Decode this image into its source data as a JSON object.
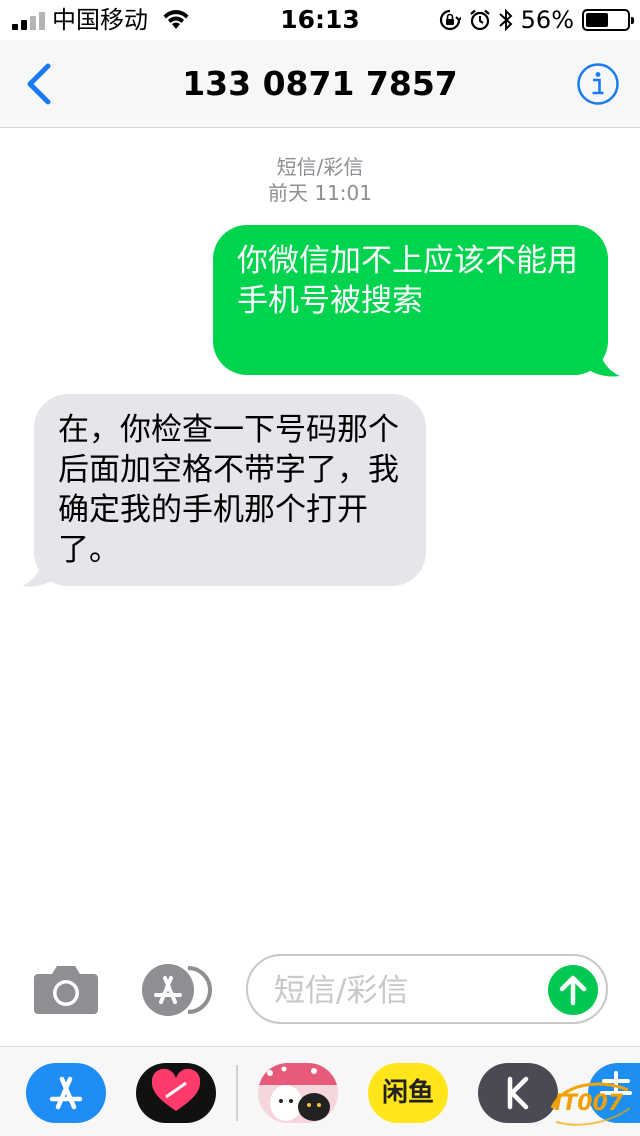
{
  "status_bar": {
    "carrier": "中国移动",
    "time": "16:13",
    "battery_percent": "56%",
    "battery_level": 0.56
  },
  "nav": {
    "contact": "133 0871 7857"
  },
  "conversation": {
    "service_label": "短信/彩信",
    "timestamp": "前天 11:01",
    "messages": [
      {
        "direction": "sent",
        "text": "你微信加不上应该不能用手机号被搜索"
      },
      {
        "direction": "received",
        "text": "在，你检查一下号码那个后面加空格不带字了，我确定我的手机那个打开了。"
      }
    ]
  },
  "input": {
    "placeholder": "短信/彩信"
  },
  "app_drawer": {
    "apps": [
      "app-store-icon",
      "digital-touch-icon",
      "sticker-icon",
      "xianyu-icon",
      "kuaishou-icon",
      "alipay-icon"
    ],
    "xianyu_label": "闲鱼"
  },
  "watermark": "IT007",
  "colors": {
    "accent": "#1a7cf5",
    "sent_bubble": "#00d44f",
    "received_bubble": "#e5e5ea",
    "send_button": "#00c850"
  }
}
